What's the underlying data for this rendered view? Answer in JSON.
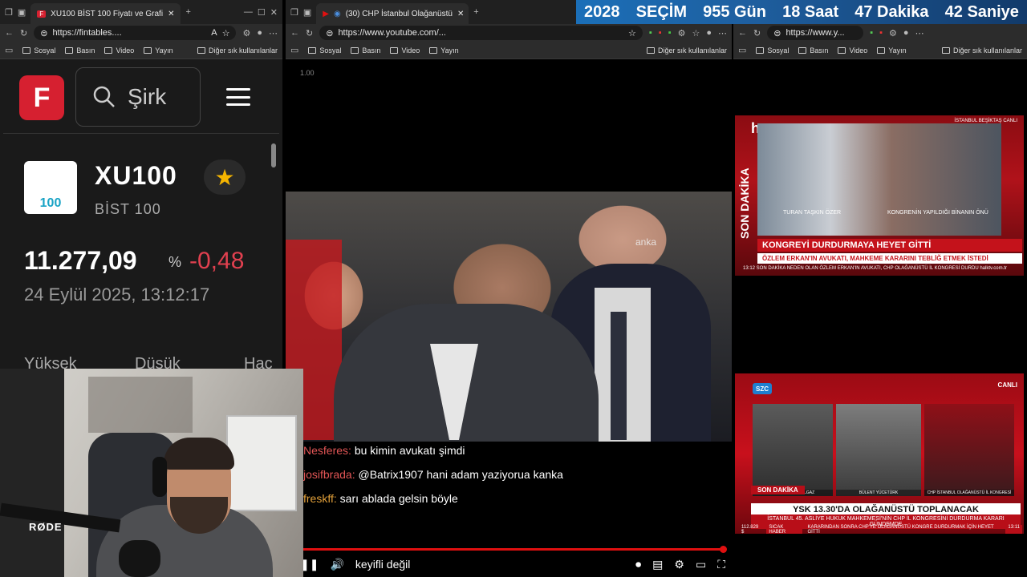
{
  "left_window": {
    "tab_title": "XU100 BİST 100 Fiyatı ve Grafi",
    "url": "https://fintables....",
    "bookmarks": [
      "Sosyal",
      "Basın",
      "Video",
      "Yayın"
    ],
    "other_bookmarks": "Diğer sık kullanılanlar",
    "search_placeholder": "Şirk",
    "logo_letter": "F",
    "stock": {
      "logo_text": "100",
      "symbol": "XU100",
      "name": "BİST 100",
      "price": "11.277,09",
      "pct_symbol": "%",
      "change": "-0,48",
      "datetime": "24 Eylül 2025, 13:12:17",
      "columns": [
        "Yüksek",
        "Düşük",
        "Hac"
      ]
    }
  },
  "middle_window": {
    "tab_title": "(30) CHP İstanbul Olağanüstü",
    "url": "https://www.youtube.com/...",
    "bookmarks": [
      "Sosyal",
      "Basın",
      "Video",
      "Yayın"
    ],
    "other_bookmarks": "Diğer sık kullanılanlar",
    "zoom_label": "1.00",
    "watermark": "anka",
    "chat": [
      {
        "user": "Nesferes:",
        "text": "bu kimin avukatı şimdi",
        "color": "red"
      },
      {
        "user": "josifbrada:",
        "text": "@Batrix1907 hani adam yaziyorua kanka",
        "color": "red"
      },
      {
        "user": "freskff:",
        "text": "sarı ablada gelsin böyle",
        "color": "orange"
      }
    ],
    "caption": "keyifli değil"
  },
  "right_window": {
    "url": "https://www.y...",
    "bookmarks": [
      "Sosyal",
      "Basın",
      "Video",
      "Yayın"
    ],
    "other_bookmarks": "Diğer sık kullanılanlar",
    "countdown": [
      "2028",
      "SEÇİM",
      "955 Gün",
      "18 Saat",
      "47 Dakika",
      "42 Saniye"
    ],
    "news1": {
      "channel": "h",
      "side": "SON DAKİKA",
      "location": "İSTANBUL BEŞİKTAŞ  CANLI",
      "lbl1": "TURAN TAŞKIN ÖZER",
      "lbl2": "KONGRENİN YAPILDIĞI BİNANIN ÖNÜ",
      "head": "KONGREYİ DURDURMAYA HEYET GİTTİ",
      "sub": "ÖZLEM ERKAN'IN AVUKATI, MAHKEME KARARINI TEBLİĞ ETMEK İSTEDİ",
      "ticker": "13:12  SON DAKİKA  NEDEN OLAN ÖZLEM ERKAN'IN AVUKATI, CHP OLAĞANÜSTÜ İL KONGRESİ DURDU   halktv.com.tr"
    },
    "news2": {
      "channel": "SZC",
      "live": "CANLI",
      "tag": "SON DAKİKA",
      "panel1": "SENEM TOLUAY İLGAZ",
      "panel2": "BÜLENT YÜCETÜRK",
      "panel3": "CHP İSTANBUL OLAĞANÜSTÜ İL KONGRESİ",
      "head": "YSK 13.30'DA OLAĞANÜSTÜ TOPLANACAK",
      "sub": "İSTANBUL 45. ASLİYE HUKUK MAHKEMESİ'NİN CHP İL KONGRESİNİ DURDURMA KARARI GÜNDEMDE",
      "ticker_value": "112.829 $",
      "ticker_tag": "SICAK HABER",
      "ticker_text": "KARARINDAN SONRA CHP'YE OLAĞANÜSTÜ KONGRE DURDURMAK İÇİN HEYET GİTTİ",
      "time": "13:11"
    }
  },
  "webcam": {
    "mic_brand": "RØDE"
  },
  "colors": {
    "accent_red": "#d62030",
    "negative": "#e0404f",
    "star": "#f4b400",
    "countdown_bg": "#1b6fb8"
  }
}
